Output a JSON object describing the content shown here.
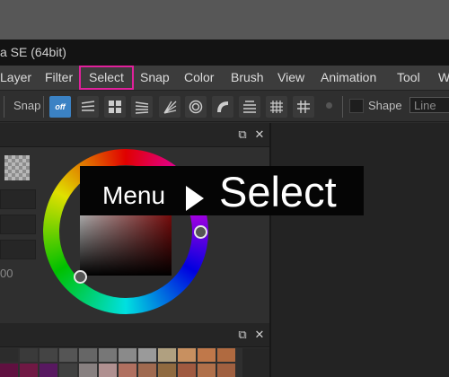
{
  "window": {
    "title": "a SE (64bit)"
  },
  "menubar": {
    "items": [
      {
        "label": "Layer"
      },
      {
        "label": "Filter"
      },
      {
        "label": "Select"
      },
      {
        "label": "Snap"
      },
      {
        "label": "Color"
      },
      {
        "label": "Brush"
      },
      {
        "label": "View"
      },
      {
        "label": "Animation"
      },
      {
        "label": "Tool"
      },
      {
        "label": "W"
      }
    ],
    "highlighted": "Select",
    "highlight_color": "#e0219b"
  },
  "toolbar": {
    "snap_label": "Snap",
    "snap_off_text": "off",
    "snap_icons": [
      "snap-off-icon",
      "snap-parallel-lines-icon",
      "snap-grid-icon",
      "snap-perspective-lines-icon",
      "snap-radial-lines-icon",
      "snap-concentric-icon",
      "snap-curve-icon",
      "snap-3d-icon",
      "snap-cross-grid-icon",
      "snap-grid-2-icon",
      "snap-vanishing-icon"
    ],
    "shape_label": "Shape",
    "shape_value": "Line",
    "accent_color": "#3b82c4"
  },
  "color_panel": {
    "value_text": "00"
  },
  "overlay": {
    "prefix": "Menu",
    "target": "Select"
  },
  "swatches": {
    "colors_row1": [
      "#2c2c2c",
      "#3a3a3a",
      "#444444",
      "#555555",
      "#666666",
      "#777777",
      "#8a8a8a",
      "#9a9a9a",
      "#b0a080",
      "#c89060",
      "#c0784a",
      "#b06a40"
    ],
    "colors_row2": [
      "#601040",
      "#701844",
      "#581860",
      "#404040",
      "#888080",
      "#b09090",
      "#b07060",
      "#a06a50",
      "#906a40",
      "#a05a40",
      "#b0704a",
      "#a06040"
    ]
  }
}
